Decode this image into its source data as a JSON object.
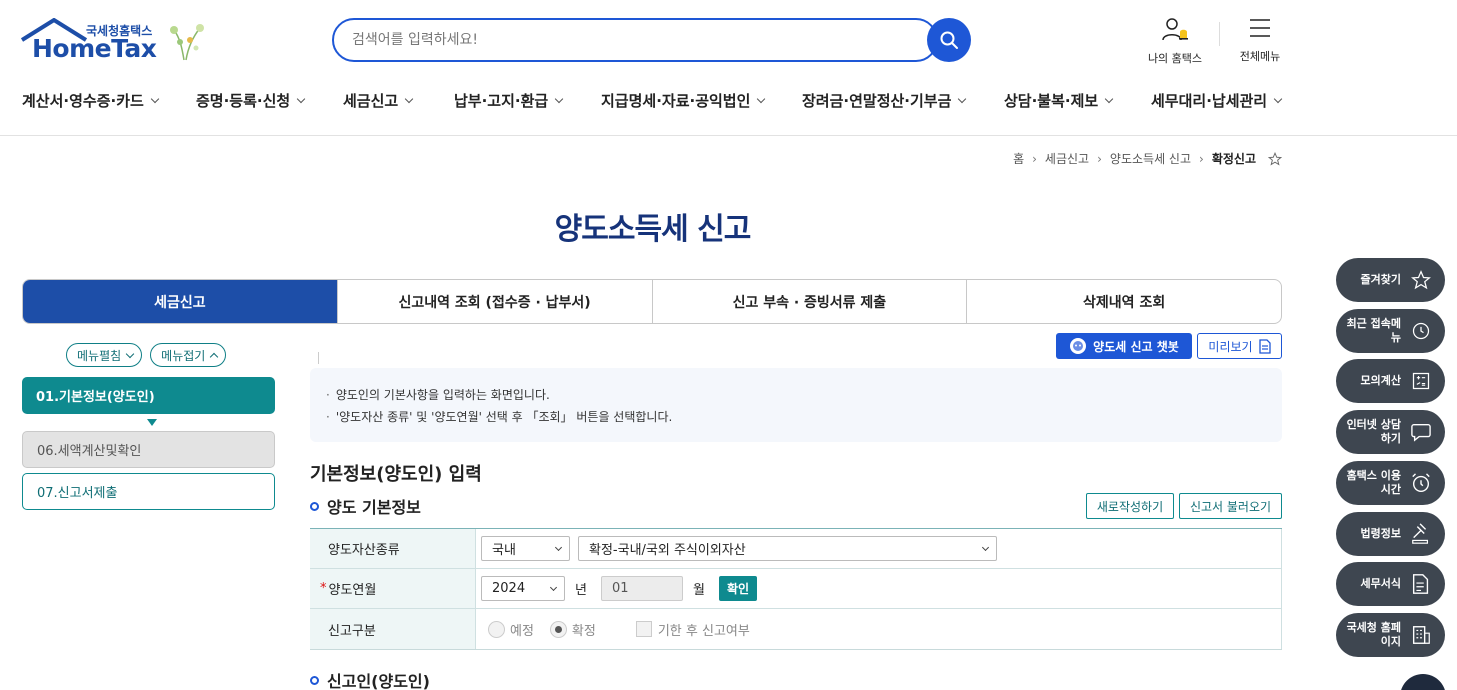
{
  "header": {
    "logo_top": "국세청홈택스",
    "logo_main": "HomeTax",
    "search_placeholder": "검색어를 입력하세요!",
    "my_hometax": "나의 홈택스",
    "all_menu": "전체메뉴"
  },
  "gnb": [
    "계산서·영수증·카드",
    "증명·등록·신청",
    "세금신고",
    "납부·고지·환급",
    "지급명세·자료·공익법인",
    "장려금·연말정산·기부금",
    "상담·불복·제보",
    "세무대리·납세관리"
  ],
  "breadcrumb": {
    "home": "홈",
    "b1": "세금신고",
    "b2": "양도소득세 신고",
    "current": "확정신고"
  },
  "page_title": "양도소득세 신고",
  "tabs": [
    "세금신고",
    "신고내역 조회 (접수증 · 납부서)",
    "신고 부속 · 증빙서류 제출",
    "삭제내역 조회"
  ],
  "left_menu": {
    "expand": "메뉴펼침",
    "collapse": "메뉴접기",
    "steps": [
      "01.기본정보(양도인)",
      "06.세액계산및확인",
      "07.신고서제출"
    ]
  },
  "actions": {
    "chatbot": "양도세 신고 챗봇",
    "preview": "미리보기",
    "new_write": "새로작성하기",
    "load_report": "신고서 불러오기",
    "confirm": "확인"
  },
  "info": [
    "양도인의 기본사항을 입력하는 화면입니다.",
    "'양도자산 종류' 및 '양도연월' 선택 후 「조회」 버튼을 선택합니다."
  ],
  "section_title": "기본정보(양도인) 입력",
  "subsection1": "양도 기본정보",
  "subsection2": "신고인(양도인)",
  "form": {
    "asset_type_label": "양도자산종류",
    "asset_region": "국내",
    "asset_kind": "확정-국내/국외 주식이외자산",
    "transfer_month_label": "양도연월",
    "required_mark": "*",
    "year": "2024",
    "year_unit": "년",
    "month": "01",
    "month_unit": "월",
    "report_type_label": "신고구분",
    "radio_planned": "예정",
    "radio_final": "확정",
    "after_deadline": "기한 후 신고여부"
  },
  "quick_menu": [
    {
      "label": "즐겨찾기",
      "icon": "star-icon"
    },
    {
      "label": "최근 접속메뉴",
      "icon": "clock-icon"
    },
    {
      "label": "모의계산",
      "icon": "calculator-icon"
    },
    {
      "label": "인터넷 상담하기",
      "icon": "chat-icon"
    },
    {
      "label": "홈택스 이용시간",
      "icon": "alarm-clock-icon"
    },
    {
      "label": "법령정보",
      "icon": "gavel-icon"
    },
    {
      "label": "세무서식",
      "icon": "document-icon"
    },
    {
      "label": "국세청 홈페이지",
      "icon": "building-icon"
    }
  ],
  "colors": {
    "brand_blue": "#1d4ea8",
    "search_blue": "#1e57d6",
    "teal": "#0e8a8f",
    "quick_bg": "#3e4650"
  }
}
